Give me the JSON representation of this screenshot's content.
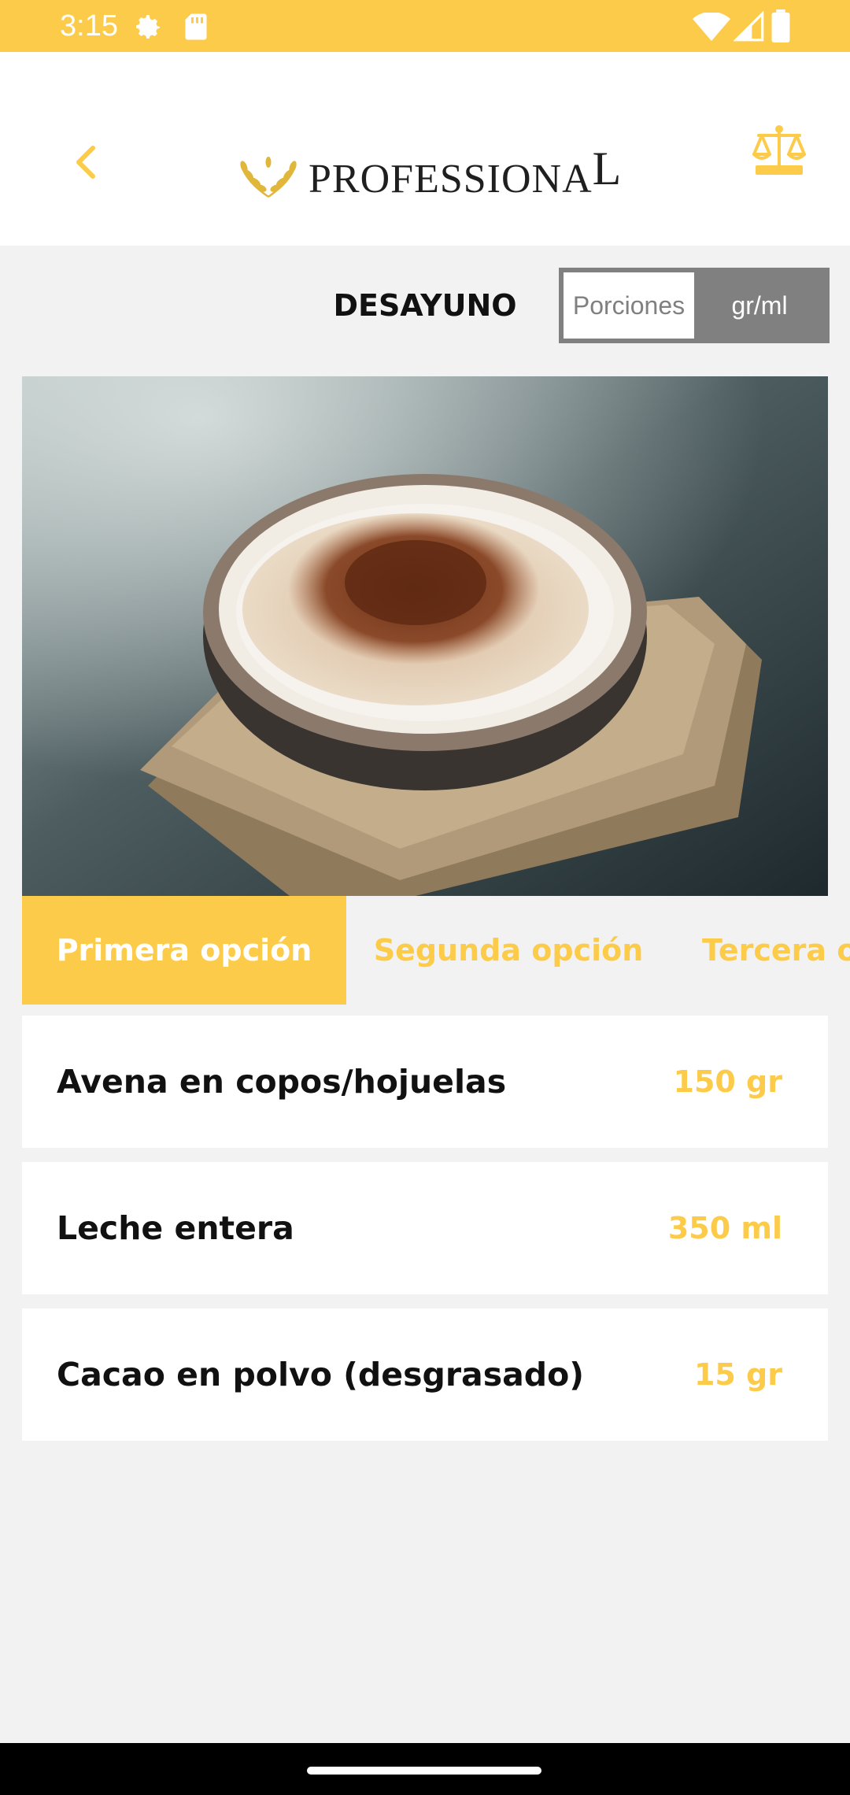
{
  "status_bar": {
    "time": "3:15",
    "icons": [
      "gear-icon",
      "sd-card-icon",
      "wifi-icon",
      "signal-icon",
      "battery-icon"
    ]
  },
  "header": {
    "brand_main": "PROFESSIONA",
    "brand_last": "L",
    "back_icon": "chevron-left-icon",
    "action_icon": "scale-icon"
  },
  "meal": {
    "title": "DESAYUNO"
  },
  "unit_toggle": {
    "options": [
      "Porciones",
      "gr/ml"
    ],
    "selected": "gr/ml"
  },
  "tabs": [
    {
      "label": "Primera opción",
      "active": true
    },
    {
      "label": "Segunda opción",
      "active": false
    },
    {
      "label": "Tercera opción",
      "active": false
    }
  ],
  "ingredients": [
    {
      "name": "Avena en copos/hojuelas",
      "qty": "150 gr"
    },
    {
      "name": "Leche entera",
      "qty": "350 ml"
    },
    {
      "name": "Cacao en polvo (desgrasado)",
      "qty": "15 gr"
    }
  ],
  "colors": {
    "accent": "#fdcb4a",
    "toggle_gray": "#808080",
    "background": "#f2f2f2"
  }
}
